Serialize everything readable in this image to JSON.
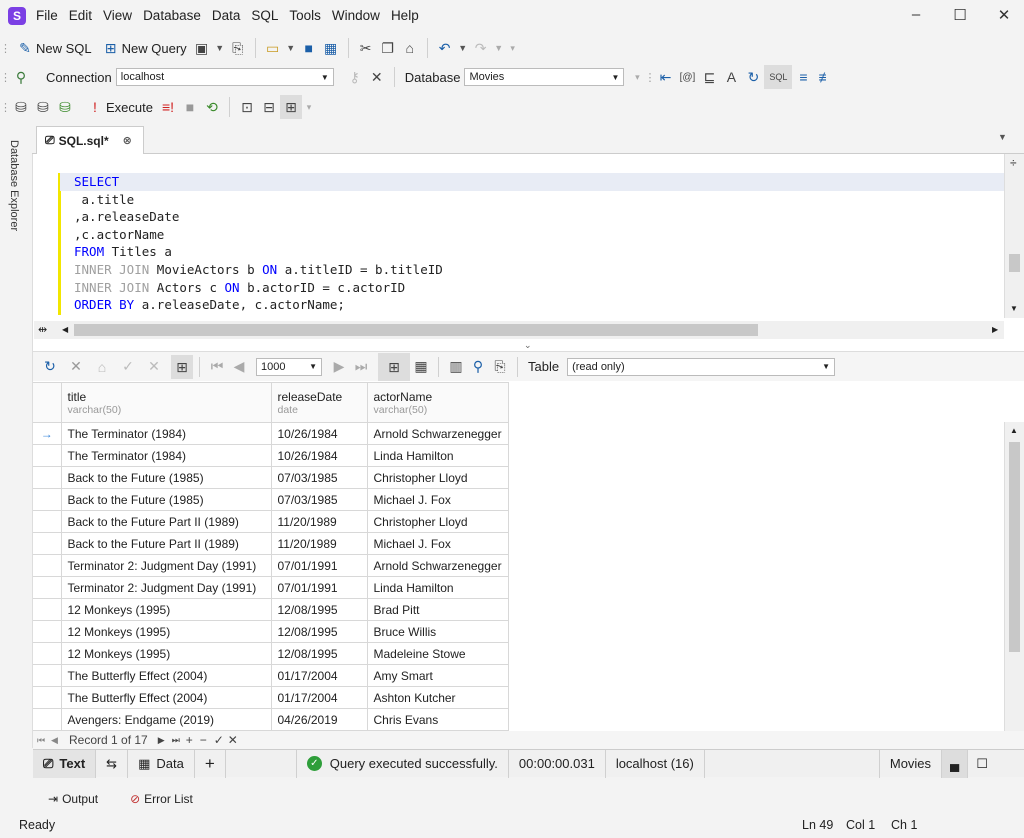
{
  "menu": [
    "File",
    "Edit",
    "View",
    "Database",
    "Data",
    "SQL",
    "Tools",
    "Window",
    "Help"
  ],
  "toolbar1": {
    "new_sql": "New SQL",
    "new_query": "New Query"
  },
  "toolbar2": {
    "connection_label": "Connection",
    "connection_value": "localhost",
    "database_label": "Database",
    "database_value": "Movies"
  },
  "toolbar3": {
    "execute": "Execute"
  },
  "sidebar": {
    "label": "Database Explorer"
  },
  "tab": {
    "title": "SQL.sql*"
  },
  "sql": {
    "l1": "SELECT",
    "l2": " a.title",
    "l3": ",a.releaseDate",
    "l4": ",c.actorName",
    "l5a": "FROM",
    "l5b": " Titles a",
    "l6a": "INNER JOIN",
    "l6b": " MovieActors b ",
    "l6c": "ON",
    "l6d": " a.titleID = b.titleID",
    "l7a": "INNER JOIN",
    "l7b": " Actors c ",
    "l7c": "ON",
    "l7d": " b.actorID = c.actorID",
    "l8a": "ORDER BY",
    "l8b": " a.releaseDate, c.actorName;"
  },
  "results_toolbar": {
    "page_size": "1000",
    "view_label": "Table",
    "view_value": "(read only)"
  },
  "grid": {
    "columns": [
      {
        "name": "title",
        "type": "varchar(50)"
      },
      {
        "name": "releaseDate",
        "type": "date"
      },
      {
        "name": "actorName",
        "type": "varchar(50)"
      }
    ],
    "rows": [
      [
        "The Terminator (1984)",
        "10/26/1984",
        "Arnold Schwarzenegger"
      ],
      [
        "The Terminator (1984)",
        "10/26/1984",
        "Linda Hamilton"
      ],
      [
        "Back to the Future (1985)",
        "07/03/1985",
        "Christopher Lloyd"
      ],
      [
        "Back to the Future (1985)",
        "07/03/1985",
        "Michael J. Fox"
      ],
      [
        "Back to the Future Part II (1989)",
        "11/20/1989",
        "Christopher Lloyd"
      ],
      [
        "Back to the Future Part II (1989)",
        "11/20/1989",
        "Michael J. Fox"
      ],
      [
        "Terminator 2: Judgment Day (1991)",
        "07/01/1991",
        "Arnold Schwarzenegger"
      ],
      [
        "Terminator 2: Judgment Day (1991)",
        "07/01/1991",
        "Linda Hamilton"
      ],
      [
        "12 Monkeys (1995)",
        "12/08/1995",
        "Brad Pitt"
      ],
      [
        "12 Monkeys (1995)",
        "12/08/1995",
        "Bruce Willis"
      ],
      [
        "12 Monkeys (1995)",
        "12/08/1995",
        "Madeleine Stowe"
      ],
      [
        "The Butterfly Effect (2004)",
        "01/17/2004",
        "Amy Smart"
      ],
      [
        "The Butterfly Effect (2004)",
        "01/17/2004",
        "Ashton Kutcher"
      ],
      [
        "Avengers: Endgame (2019)",
        "04/26/2019",
        "Chris Evans"
      ]
    ]
  },
  "record_nav": {
    "text": "Record 1 of 17"
  },
  "bottom": {
    "text_tab": "Text",
    "data_tab": "Data",
    "status": "Query executed successfully.",
    "duration": "00:00:00.031",
    "server": "localhost (16)",
    "database": "Movies"
  },
  "output": {
    "output": "Output",
    "errors": "Error List"
  },
  "status": {
    "ready": "Ready",
    "ln": "Ln 49",
    "col": "Col 1",
    "ch": "Ch 1"
  },
  "colors": {
    "accent": "#7b3fe4",
    "keyword": "#0000ff",
    "success": "#2e9e3a"
  }
}
